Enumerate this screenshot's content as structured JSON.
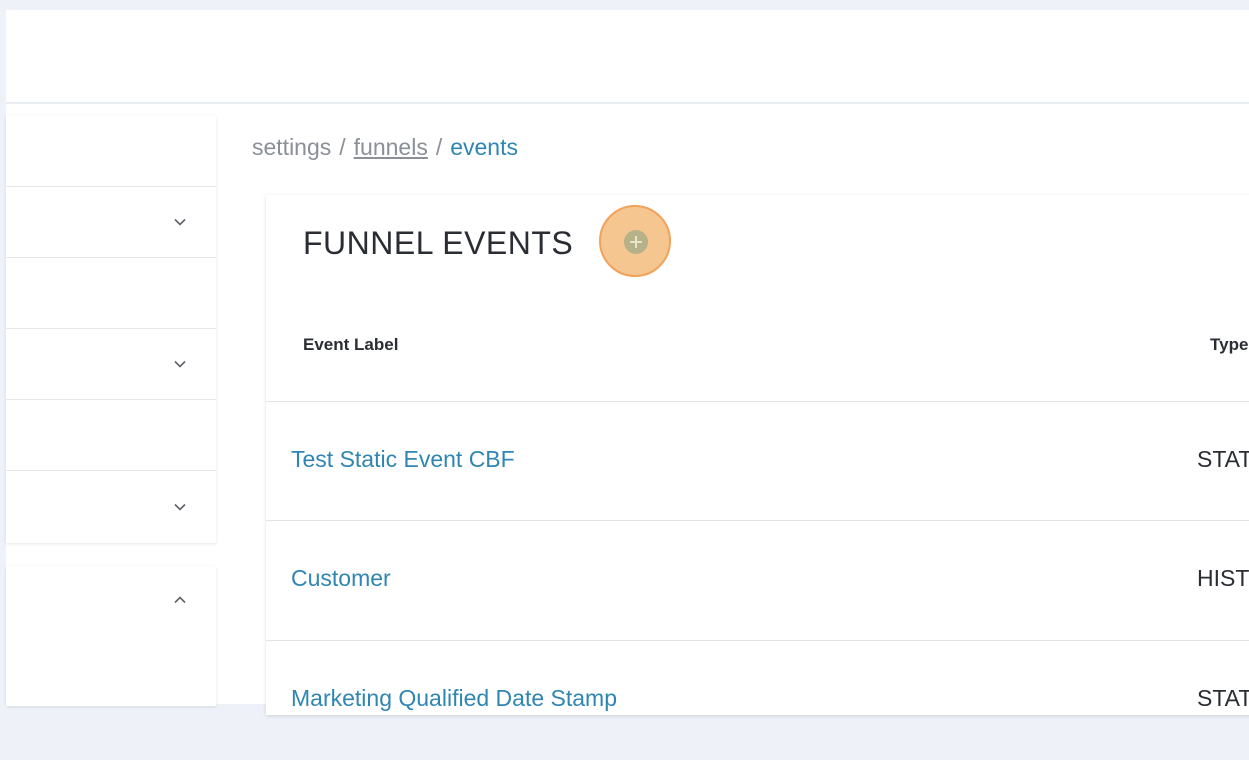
{
  "breadcrumb": {
    "root": "settings",
    "parent": "funnels",
    "current": "events",
    "separator": "/"
  },
  "card": {
    "title": "FUNNEL EVENTS",
    "add_icon": "plus-circle-icon"
  },
  "table": {
    "columns": [
      "Event Label",
      "Type"
    ],
    "rows": [
      {
        "label": "Test Static Event CBF",
        "type": "STAT"
      },
      {
        "label": "Customer",
        "type": "HIST"
      },
      {
        "label": "Marketing Qualified Date Stamp",
        "type": "STAT"
      }
    ]
  },
  "sidebar": {
    "rows": [
      {
        "chevron": "chevron-down-icon"
      },
      {
        "chevron": ""
      },
      {
        "chevron": "chevron-down-icon"
      },
      {
        "chevron": ""
      },
      {
        "chevron": "chevron-down-icon"
      }
    ],
    "section2_chevron": "chevron-up-icon"
  },
  "colors": {
    "accent": "#2f86b3",
    "highlight": "#f6c690",
    "background": "#eef1f8"
  }
}
